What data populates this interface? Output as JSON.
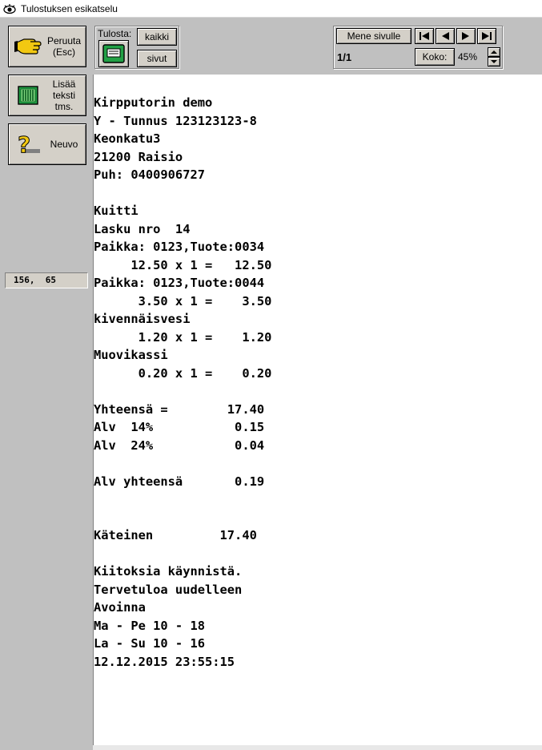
{
  "window": {
    "title": "Tulostuksen esikatselu"
  },
  "sidebar": {
    "cancel": {
      "line1": "Peruuta",
      "line2": "(Esc)"
    },
    "add_text": {
      "line1": "Lisää",
      "line2": "teksti",
      "line3": "tms."
    },
    "help": {
      "label": "Neuvo"
    },
    "coords": "156,  65"
  },
  "toolbar": {
    "print_label": "Tulosta:",
    "print_all": "kaikki",
    "print_pages": "sivut",
    "goto_page": "Mene sivulle",
    "page_indicator": "1/1",
    "zoom_label": "Koko:",
    "zoom_value": "45%"
  },
  "receipt": {
    "lines": [
      "Kirpputorin demo",
      "Y - Tunnus 123123123-8",
      "Keonkatu3",
      "21200 Raisio",
      "Puh: 0400906727",
      "",
      "Kuitti",
      "Lasku nro  14",
      "Paikka: 0123,Tuote:0034",
      "     12.50 x 1 =   12.50",
      "Paikka: 0123,Tuote:0044",
      "      3.50 x 1 =    3.50",
      "kivennäisvesi",
      "      1.20 x 1 =    1.20",
      "Muovikassi",
      "      0.20 x 1 =    0.20",
      "",
      "Yhteensä =        17.40",
      "Alv  14%           0.15",
      "Alv  24%           0.04",
      "",
      "Alv yhteensä       0.19",
      "",
      "",
      "Käteinen         17.40",
      "",
      "Kiitoksia käynnistä.",
      "Tervetuloa uudelleen",
      "Avoinna",
      "Ma - Pe 10 - 18",
      "La - Su 10 - 16",
      "12.12.2015 23:55:15"
    ]
  }
}
